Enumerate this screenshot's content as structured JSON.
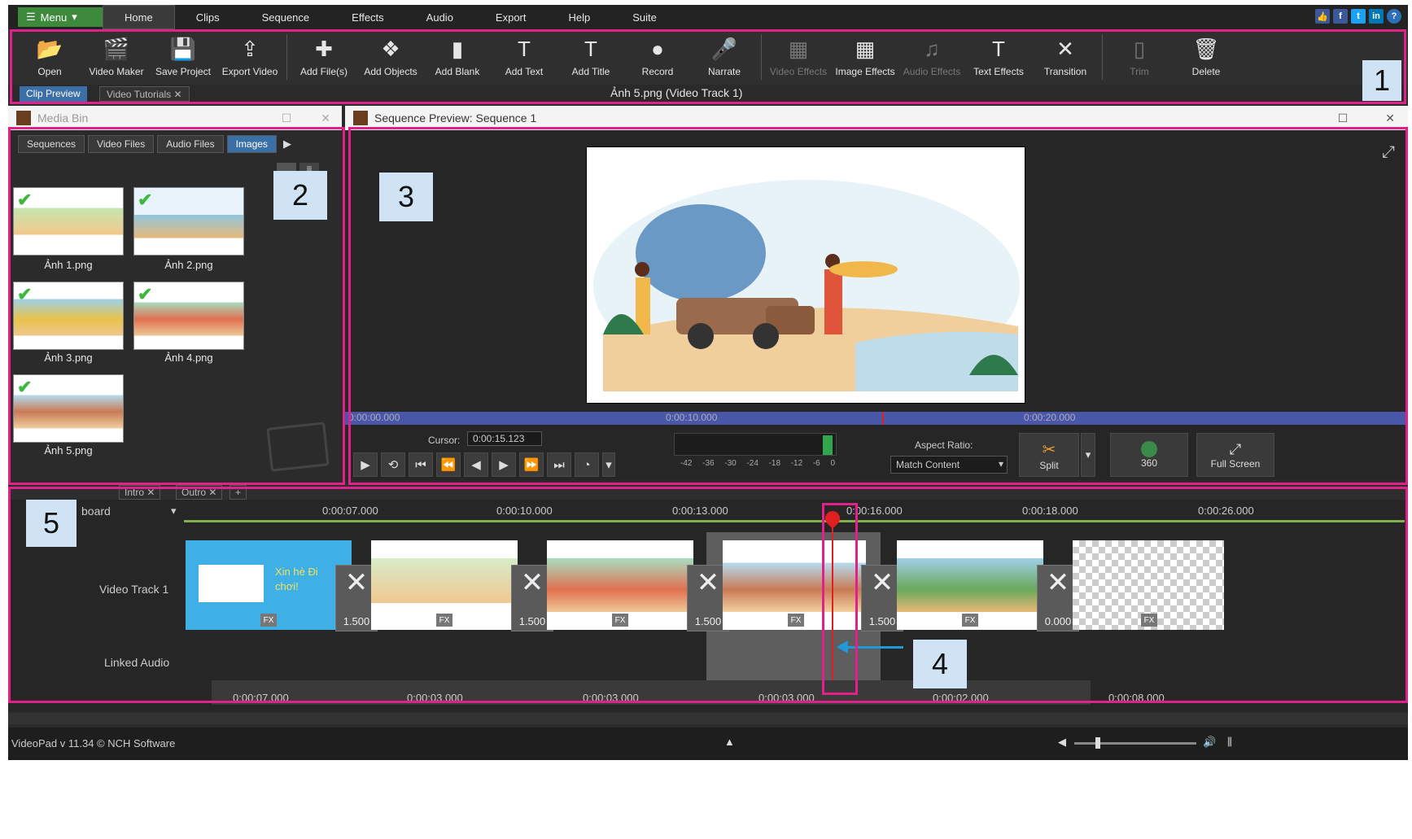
{
  "menubar": {
    "menu_label": "Menu",
    "items": [
      "Home",
      "Clips",
      "Sequence",
      "Effects",
      "Audio",
      "Export",
      "Help",
      "Suite"
    ],
    "active": "Home",
    "social": [
      "f",
      "t",
      "in",
      "?"
    ]
  },
  "toolbar": {
    "items": [
      {
        "label": "Open",
        "icon": "folder-icon",
        "glyph": "📂",
        "enabled": true
      },
      {
        "label": "Video Maker",
        "icon": "video-maker-icon",
        "glyph": "🎬",
        "enabled": true
      },
      {
        "label": "Save Project",
        "icon": "save-icon",
        "glyph": "💾",
        "enabled": true
      },
      {
        "label": "Export Video",
        "icon": "export-video-icon",
        "glyph": "⇪",
        "enabled": true
      },
      {
        "label": "Add File(s)",
        "icon": "add-files-icon",
        "glyph": "✚",
        "enabled": true
      },
      {
        "label": "Add Objects",
        "icon": "add-objects-icon",
        "glyph": "❖",
        "enabled": true
      },
      {
        "label": "Add Blank",
        "icon": "add-blank-icon",
        "glyph": "▮",
        "enabled": true
      },
      {
        "label": "Add Text",
        "icon": "add-text-icon",
        "glyph": "T",
        "enabled": true
      },
      {
        "label": "Add Title",
        "icon": "add-title-icon",
        "glyph": "T",
        "enabled": true
      },
      {
        "label": "Record",
        "icon": "record-icon",
        "glyph": "●",
        "enabled": true
      },
      {
        "label": "Narrate",
        "icon": "microphone-icon",
        "glyph": "🎤",
        "enabled": true
      },
      {
        "label": "Video Effects",
        "icon": "video-effects-icon",
        "glyph": "▦",
        "enabled": false
      },
      {
        "label": "Image Effects",
        "icon": "image-effects-icon",
        "glyph": "▦",
        "enabled": true
      },
      {
        "label": "Audio Effects",
        "icon": "audio-effects-icon",
        "glyph": "♫",
        "enabled": false
      },
      {
        "label": "Text Effects",
        "icon": "text-effects-icon",
        "glyph": "T",
        "enabled": true
      },
      {
        "label": "Transition",
        "icon": "transition-icon",
        "glyph": "✕",
        "enabled": true
      },
      {
        "label": "Trim",
        "icon": "trim-icon",
        "glyph": "▯",
        "enabled": false
      },
      {
        "label": "Delete",
        "icon": "trash-icon",
        "glyph": "🗑",
        "enabled": true
      }
    ]
  },
  "subtabs": {
    "clip_preview": "Clip Preview",
    "video_tutorials": "Video Tutorials",
    "title": "Ảnh 5.png (Video Track 1)"
  },
  "mediabin": {
    "title": "Media Bin",
    "tabs": [
      "Sequences",
      "Video Files",
      "Audio Files",
      "Images"
    ],
    "images": [
      {
        "caption": "Ảnh 1.png"
      },
      {
        "caption": "Ảnh 2.png"
      },
      {
        "caption": "Ảnh 3.png"
      },
      {
        "caption": "Ảnh 4.png"
      },
      {
        "caption": "Ảnh 5.png"
      }
    ]
  },
  "preview": {
    "title": "Sequence Preview: Sequence 1",
    "ruler": [
      "0:00:00.000",
      "0:00:10.000",
      "0:00:20.000"
    ],
    "cursor_label": "Cursor:",
    "cursor_value": "0:00:15.123",
    "meter_ticks": [
      "-42",
      "-36",
      "-30",
      "-24",
      "-18",
      "-12",
      "-6",
      "0"
    ],
    "aspect_label": "Aspect Ratio:",
    "aspect_value": "Match Content",
    "split_label": "Split",
    "vr_label": "360",
    "fullscreen_label": "Full Screen"
  },
  "timeline": {
    "tabs": [
      "Intro",
      "Outro"
    ],
    "board_label": "board",
    "ruler": [
      "0:00:07.000",
      "0:00:10.000",
      "0:00:13.000",
      "0:00:16.000",
      "0:00:18.000",
      "0:00:26.000"
    ],
    "track_label": "Video Track 1",
    "audio_label": "Linked Audio",
    "transitions": [
      "1.500",
      "1.500",
      "1.500",
      "1.500",
      "0.000"
    ],
    "intro_text": "Xin hè Đi chơi!",
    "bottom_ruler": [
      "0:00:07.000",
      "0:00:03.000",
      "0:00:03.000",
      "0:00:03.000",
      "0:00:02.000",
      "0:00:08.000"
    ]
  },
  "status": {
    "version": "VideoPad v 11.34 © NCH Software"
  },
  "annotations": [
    "1",
    "2",
    "3",
    "4",
    "5"
  ],
  "colors": {
    "accent": "#e0218a",
    "selection": "#3b6fa8",
    "playhead": "#e02020",
    "menu_green": "#3d8a3d"
  }
}
